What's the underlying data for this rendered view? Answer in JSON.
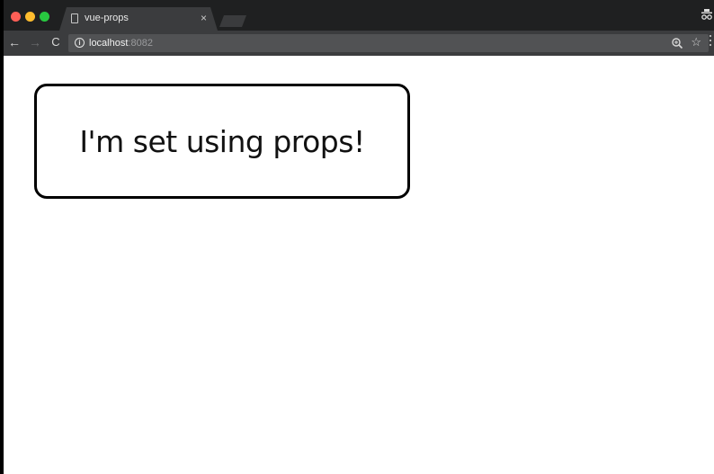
{
  "browser": {
    "tab": {
      "title": "vue-props",
      "close_glyph": "×",
      "page_icon": "page-icon"
    },
    "window_controls": {
      "close_color": "#fe5f57",
      "minimize_color": "#febc2e",
      "maximize_color": "#28c840"
    },
    "toolbar": {
      "back_glyph": "←",
      "forward_glyph": "→",
      "reload_glyph": "C",
      "info_glyph": "i",
      "star_glyph": "☆"
    },
    "address_bar": {
      "host": "localhost",
      "port": ":8082"
    },
    "icons": {
      "incognito": "incognito-icon",
      "zoom": "zoom-icon",
      "menu": "menu-icon"
    }
  },
  "page": {
    "message": "I'm set using props!"
  }
}
